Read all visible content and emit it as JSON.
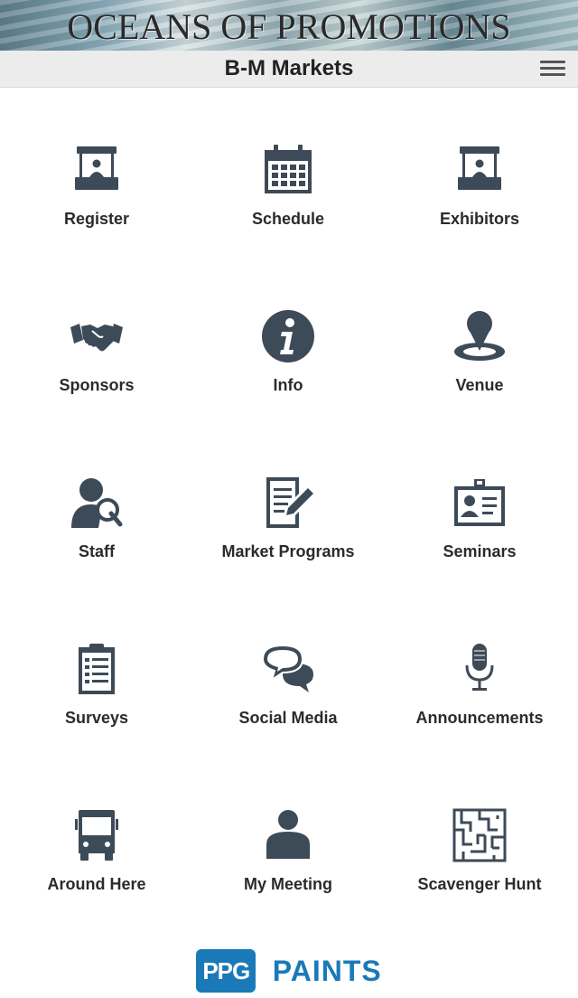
{
  "banner": {
    "title": "OCEANS OF PROMOTIONS"
  },
  "appbar": {
    "title": "B-M Markets"
  },
  "colors": {
    "icon": "#3d4a57",
    "brand_blue": "#1a7ab8",
    "appbar_bg": "#ececec"
  },
  "menu": [
    {
      "label": "Register",
      "icon": "booth-icon"
    },
    {
      "label": "Schedule",
      "icon": "calendar-icon"
    },
    {
      "label": "Exhibitors",
      "icon": "booth-icon"
    },
    {
      "label": "Sponsors",
      "icon": "handshake-icon"
    },
    {
      "label": "Info",
      "icon": "info-icon"
    },
    {
      "label": "Venue",
      "icon": "location-pin-icon"
    },
    {
      "label": "Staff",
      "icon": "person-search-icon"
    },
    {
      "label": "Market Programs",
      "icon": "document-edit-icon"
    },
    {
      "label": "Seminars",
      "icon": "id-badge-icon"
    },
    {
      "label": "Surveys",
      "icon": "clipboard-icon"
    },
    {
      "label": "Social Media",
      "icon": "chat-bubbles-icon"
    },
    {
      "label": "Announcements",
      "icon": "microphone-icon"
    },
    {
      "label": "Around Here",
      "icon": "bus-icon"
    },
    {
      "label": "My Meeting",
      "icon": "person-icon"
    },
    {
      "label": "Scavenger Hunt",
      "icon": "maze-icon"
    }
  ],
  "footer": {
    "logo_mark": "PPG",
    "logo_text": "PAINTS"
  }
}
